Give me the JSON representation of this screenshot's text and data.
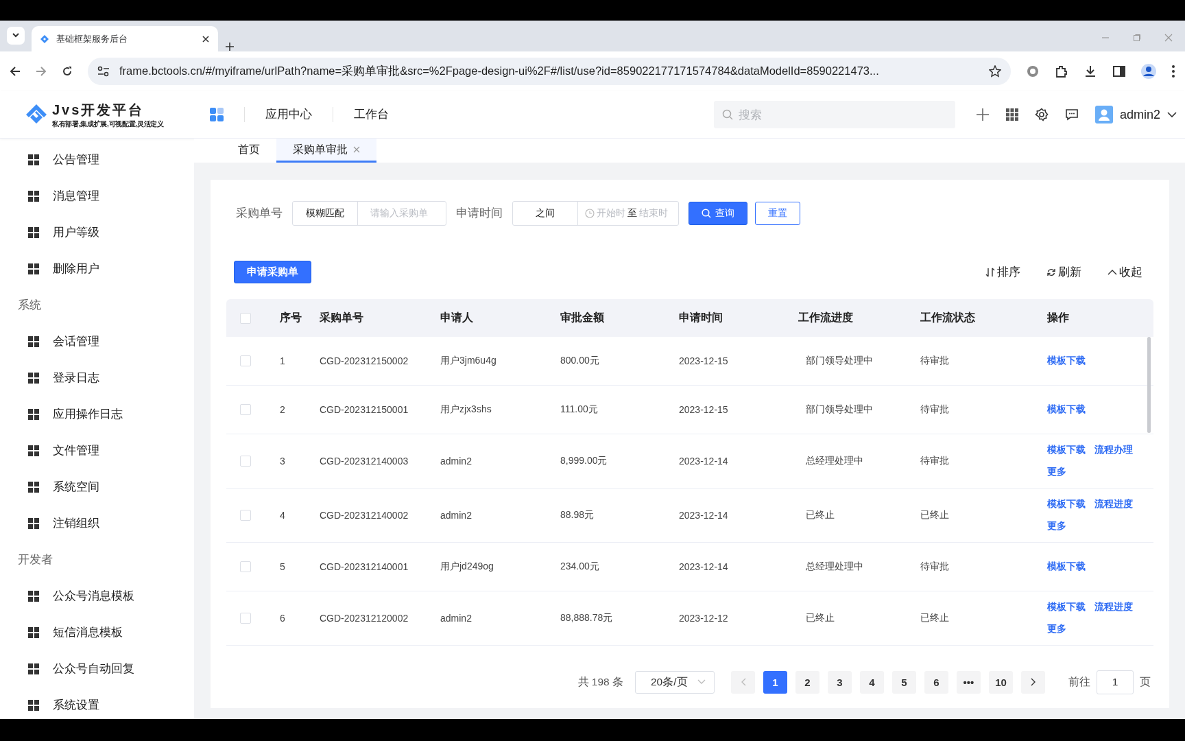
{
  "browser": {
    "tab_title": "基础框架服务后台",
    "url": "frame.bctools.cn/#/myiframe/urlPath?name=采购单审批&src=%2Fpage-design-ui%2F#/list/use?id=859022177171574784&dataModelId=8590221473..."
  },
  "header": {
    "logo_title": "Jvs开发平台",
    "logo_subtitle": "私有部署,集成扩展,可视配置,灵活定义",
    "nav": [
      "应用中心",
      "工作台"
    ],
    "search_placeholder": "搜索",
    "user": "admin2"
  },
  "sidebar": [
    {
      "items": [
        "公告管理",
        "消息管理",
        "用户等级",
        "删除用户"
      ]
    },
    {
      "title": "系统",
      "items": [
        "会话管理",
        "登录日志",
        "应用操作日志",
        "文件管理",
        "系统空间",
        "注销组织"
      ]
    },
    {
      "title": "开发者",
      "items": [
        "公众号消息模板",
        "短信消息模板",
        "公众号自动回复",
        "系统设置"
      ]
    }
  ],
  "page_tabs": [
    {
      "label": "首页",
      "selected": false,
      "closable": false
    },
    {
      "label": "采购单审批",
      "selected": true,
      "closable": true
    }
  ],
  "filters": {
    "order_label": "采购单号",
    "order_mode": "模糊匹配",
    "order_placeholder": "请输入采购单",
    "time_label": "申请时间",
    "time_mode": "之间",
    "start_placeholder": "开始时",
    "separator": "至",
    "end_placeholder": "结束时",
    "query": "查询",
    "reset": "重置"
  },
  "create_button": "申请采购单",
  "toolbar": [
    "排序",
    "刷新",
    "收起"
  ],
  "table": {
    "all_checked": false,
    "columns": [
      "序号",
      "采购单号",
      "申请人",
      "审批金额",
      "申请时间",
      "工作流进度",
      "工作流状态",
      "操作"
    ],
    "rows": [
      {
        "checked": false,
        "cells": [
          "1",
          "CGD-202312150002",
          "用户3jm6u4g",
          "800.00元",
          "2023-12-15",
          "部门领导处理中",
          "待审批"
        ],
        "actions": [
          "模板下载"
        ]
      },
      {
        "checked": false,
        "cells": [
          "2",
          "CGD-202312150001",
          "用户zjx3shs",
          "111.00元",
          "2023-12-15",
          "部门领导处理中",
          "待审批"
        ],
        "actions": [
          "模板下载"
        ]
      },
      {
        "checked": false,
        "cells": [
          "3",
          "CGD-202312140003",
          "admin2",
          "8,999.00元",
          "2023-12-14",
          "总经理处理中",
          "待审批"
        ],
        "actions": [
          "模板下载",
          "流程办理",
          "更多"
        ]
      },
      {
        "checked": false,
        "cells": [
          "4",
          "CGD-202312140002",
          "admin2",
          "88.98元",
          "2023-12-14",
          "已终止",
          "已终止"
        ],
        "actions": [
          "模板下载",
          "流程进度",
          "更多"
        ]
      },
      {
        "checked": false,
        "cells": [
          "5",
          "CGD-202312140001",
          "用户jd249og",
          "234.00元",
          "2023-12-14",
          "总经理处理中",
          "待审批"
        ],
        "actions": [
          "模板下载"
        ]
      },
      {
        "checked": false,
        "cells": [
          "6",
          "CGD-202312120002",
          "admin2",
          "88,888.78元",
          "2023-12-12",
          "已终止",
          "已终止"
        ],
        "actions": [
          "模板下载",
          "流程进度",
          "更多"
        ]
      }
    ]
  },
  "pagination": {
    "total": "共 198 条",
    "page_size": "20条/页",
    "pages": [
      {
        "label": "1",
        "selected": true
      },
      {
        "label": "2",
        "selected": false
      },
      {
        "label": "3",
        "selected": false
      },
      {
        "label": "4",
        "selected": false
      },
      {
        "label": "5",
        "selected": false
      },
      {
        "label": "6",
        "selected": false
      },
      {
        "label": "•••",
        "selected": false
      },
      {
        "label": "10",
        "selected": false
      }
    ],
    "jump_label": "前往",
    "jump_value": "1",
    "jump_unit": "页"
  }
}
